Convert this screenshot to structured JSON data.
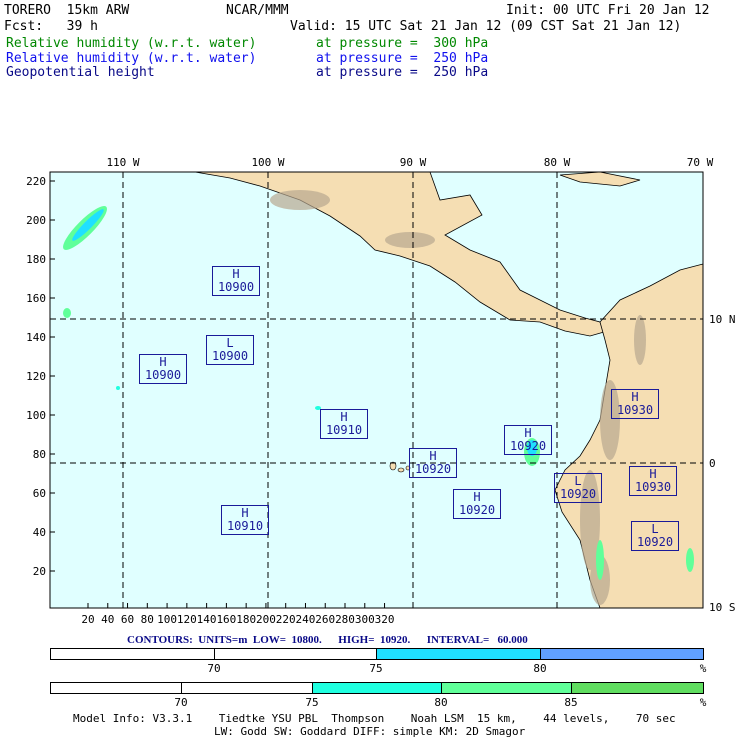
{
  "header": {
    "title": "TORERO  15km ARW",
    "org": "NCAR/MMM",
    "init": "Init: 00 UTC Fri 20 Jan 12",
    "fcst": "Fcst:   39 h",
    "valid": "Valid: 15 UTC Sat 21 Jan 12 (09 CST Sat 21 Jan 12)",
    "fields": [
      {
        "name": "Relative humidity (w.r.t. water)",
        "level": "at pressure =  300 hPa",
        "color": "#008800"
      },
      {
        "name": "Relative humidity (w.r.t. water)",
        "level": "at pressure =  250 hPa",
        "color": "#1010ee"
      },
      {
        "name": "Geopotential height",
        "level": "at pressure =  250 hPa",
        "color": "#0a0a88"
      }
    ]
  },
  "map": {
    "lon_labels": [
      "110 W",
      "100 W",
      "90 W",
      "80 W",
      "70 W"
    ],
    "lat_labels": [
      "10 N",
      "0",
      "10 S"
    ],
    "x_ticks": [
      "20",
      "40",
      "60",
      "80",
      "100",
      "120",
      "140",
      "160",
      "180",
      "200",
      "220",
      "240",
      "260",
      "280",
      "300",
      "320"
    ],
    "y_ticks": [
      "220",
      "200",
      "180",
      "160",
      "140",
      "120",
      "100",
      "80",
      "60",
      "40",
      "20"
    ],
    "centers": [
      {
        "type": "H",
        "value": "10900"
      },
      {
        "type": "L",
        "value": "10900"
      },
      {
        "type": "H",
        "value": "10900"
      },
      {
        "type": "H",
        "value": "10910"
      },
      {
        "type": "H",
        "value": "10920"
      },
      {
        "type": "H",
        "value": "10920"
      },
      {
        "type": "H",
        "value": "10920"
      },
      {
        "type": "H",
        "value": "10910"
      },
      {
        "type": "L",
        "value": "10920"
      },
      {
        "type": "H",
        "value": "10930"
      },
      {
        "type": "H",
        "value": "10930"
      },
      {
        "type": "L",
        "value": "10920"
      }
    ],
    "colors": {
      "ocean": "#e0ffff",
      "land": "#f5deb3"
    }
  },
  "contours": "CONTOURS:  UNITS=m  LOW=  10800.      HIGH=  10920.      INTERVAL=   60.000",
  "colorbar1": {
    "labels": [
      "70",
      "75",
      "80",
      "%"
    ],
    "colors": [
      "#ffffff",
      "#ffffff",
      "#20e0ff",
      "#60a0ff"
    ]
  },
  "colorbar2": {
    "labels": [
      "70",
      "75",
      "80",
      "85",
      "%"
    ],
    "colors": [
      "#ffffff",
      "#ffffff",
      "#20ffe0",
      "#60ff99",
      "#60dd60"
    ]
  },
  "model_info": {
    "line1": "Model Info: V3.3.1    Tiedtke YSU PBL  Thompson    Noah LSM  15 km,    44 levels,    70 sec",
    "line2": "LW: Godd SW: Goddard DIFF: simple KM: 2D Smagor"
  }
}
